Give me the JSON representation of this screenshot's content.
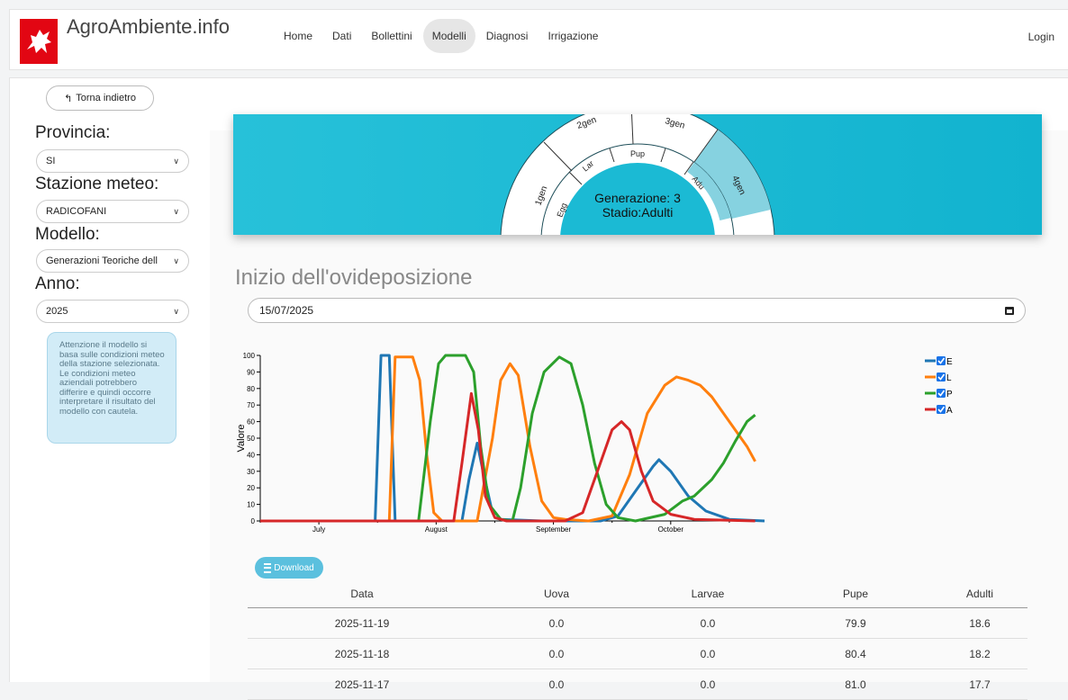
{
  "header": {
    "brand": "AgroAmbiente.info",
    "nav": [
      "Home",
      "Dati",
      "Bollettini",
      "Modelli",
      "Diagnosi",
      "Irrigazione"
    ],
    "active": "Modelli",
    "login": "Login"
  },
  "sidebar": {
    "back": "Torna indietro",
    "provincia_label": "Provincia:",
    "provincia_value": "SI",
    "stazione_label": "Stazione meteo:",
    "stazione_value": "RADICOFANI",
    "modello_label": "Modello:",
    "modello_value": "Generazioni Teoriche dell",
    "anno_label": "Anno:",
    "anno_value": "2025",
    "warning": "Attenzione il modello si basa sulle condizioni meteo della stazione selezionata. Le condizioni meteo aziendali potrebbero differire e quindi occorre interpretare il risultato del modello con cautela."
  },
  "banner": {
    "generations": [
      "1gen",
      "2gen",
      "3gen",
      "4gen"
    ],
    "stages": [
      "Egg",
      "Lar",
      "Pup",
      "Adu"
    ],
    "generazione": "Generazione: 3",
    "stadio": "Stadio:Adulti",
    "colors": {
      "bg": "#1bbad4",
      "highlight": "#86d2e0",
      "ring": "#ffffff"
    }
  },
  "page": {
    "title": "Inizio dell'ovideposizione",
    "date": "15/07/2025"
  },
  "chart_data": {
    "type": "line",
    "ylabel": "Valore",
    "ylim": [
      0,
      100
    ],
    "yticks": [
      0,
      10,
      20,
      30,
      40,
      50,
      60,
      70,
      80,
      90,
      100
    ],
    "xticks": [
      "July",
      "August",
      "September",
      "October"
    ],
    "x_month_positions": [
      0.5,
      1.5,
      2.5,
      3.5
    ],
    "xlim_months": [
      0,
      4.3
    ],
    "legend": "top-right",
    "series": [
      {
        "name": "E",
        "color": "#1f77b4",
        "points": [
          [
            0,
            0
          ],
          [
            0.98,
            0
          ],
          [
            1.03,
            100
          ],
          [
            1.1,
            100
          ],
          [
            1.15,
            0
          ],
          [
            1.72,
            0
          ],
          [
            1.78,
            25
          ],
          [
            1.85,
            47
          ],
          [
            1.9,
            30
          ],
          [
            1.97,
            8
          ],
          [
            2.05,
            1
          ],
          [
            2.4,
            0
          ],
          [
            2.9,
            0
          ],
          [
            3.05,
            3
          ],
          [
            3.2,
            18
          ],
          [
            3.35,
            33
          ],
          [
            3.4,
            37
          ],
          [
            3.5,
            30
          ],
          [
            3.65,
            15
          ],
          [
            3.8,
            6
          ],
          [
            4.0,
            1
          ],
          [
            4.3,
            0
          ]
        ]
      },
      {
        "name": "L",
        "color": "#ff7f0e",
        "points": [
          [
            0,
            0
          ],
          [
            1.1,
            0
          ],
          [
            1.15,
            99
          ],
          [
            1.3,
            99
          ],
          [
            1.36,
            85
          ],
          [
            1.42,
            40
          ],
          [
            1.48,
            5
          ],
          [
            1.55,
            0
          ],
          [
            1.85,
            0
          ],
          [
            1.98,
            50
          ],
          [
            2.05,
            85
          ],
          [
            2.13,
            95
          ],
          [
            2.2,
            88
          ],
          [
            2.3,
            45
          ],
          [
            2.4,
            12
          ],
          [
            2.5,
            2
          ],
          [
            2.6,
            1
          ],
          [
            2.8,
            0
          ],
          [
            3.0,
            3
          ],
          [
            3.15,
            28
          ],
          [
            3.3,
            65
          ],
          [
            3.45,
            82
          ],
          [
            3.55,
            87
          ],
          [
            3.65,
            85
          ],
          [
            3.75,
            82
          ],
          [
            3.85,
            75
          ],
          [
            3.95,
            65
          ],
          [
            4.05,
            55
          ],
          [
            4.15,
            45
          ],
          [
            4.22,
            36
          ]
        ]
      },
      {
        "name": "P",
        "color": "#2ca02c",
        "points": [
          [
            0,
            0
          ],
          [
            1.35,
            0
          ],
          [
            1.45,
            60
          ],
          [
            1.52,
            95
          ],
          [
            1.58,
            100
          ],
          [
            1.75,
            100
          ],
          [
            1.82,
            90
          ],
          [
            1.88,
            45
          ],
          [
            1.95,
            10
          ],
          [
            2.05,
            1
          ],
          [
            2.15,
            0
          ],
          [
            2.22,
            20
          ],
          [
            2.32,
            65
          ],
          [
            2.42,
            90
          ],
          [
            2.55,
            99
          ],
          [
            2.65,
            95
          ],
          [
            2.75,
            70
          ],
          [
            2.85,
            35
          ],
          [
            2.95,
            10
          ],
          [
            3.05,
            2
          ],
          [
            3.2,
            0
          ],
          [
            3.45,
            4
          ],
          [
            3.6,
            12
          ],
          [
            3.7,
            15
          ],
          [
            3.85,
            25
          ],
          [
            3.95,
            35
          ],
          [
            4.05,
            48
          ],
          [
            4.15,
            60
          ],
          [
            4.22,
            64
          ]
        ]
      },
      {
        "name": "A",
        "color": "#d62728",
        "points": [
          [
            0,
            0
          ],
          [
            1.65,
            0
          ],
          [
            1.72,
            35
          ],
          [
            1.8,
            77
          ],
          [
            1.86,
            55
          ],
          [
            1.92,
            15
          ],
          [
            2.0,
            2
          ],
          [
            2.1,
            0
          ],
          [
            2.6,
            0
          ],
          [
            2.75,
            5
          ],
          [
            2.9,
            35
          ],
          [
            3.0,
            55
          ],
          [
            3.08,
            60
          ],
          [
            3.15,
            55
          ],
          [
            3.25,
            30
          ],
          [
            3.35,
            12
          ],
          [
            3.5,
            4
          ],
          [
            3.7,
            1
          ],
          [
            4.22,
            0
          ]
        ]
      }
    ]
  },
  "download": "Download",
  "table": {
    "headers": [
      "Data",
      "Uova",
      "Larvae",
      "Pupe",
      "Adulti"
    ],
    "rows": [
      [
        "2025-11-19",
        "0.0",
        "0.0",
        "79.9",
        "18.6"
      ],
      [
        "2025-11-18",
        "0.0",
        "0.0",
        "80.4",
        "18.2"
      ],
      [
        "2025-11-17",
        "0.0",
        "0.0",
        "81.0",
        "17.7"
      ]
    ]
  }
}
